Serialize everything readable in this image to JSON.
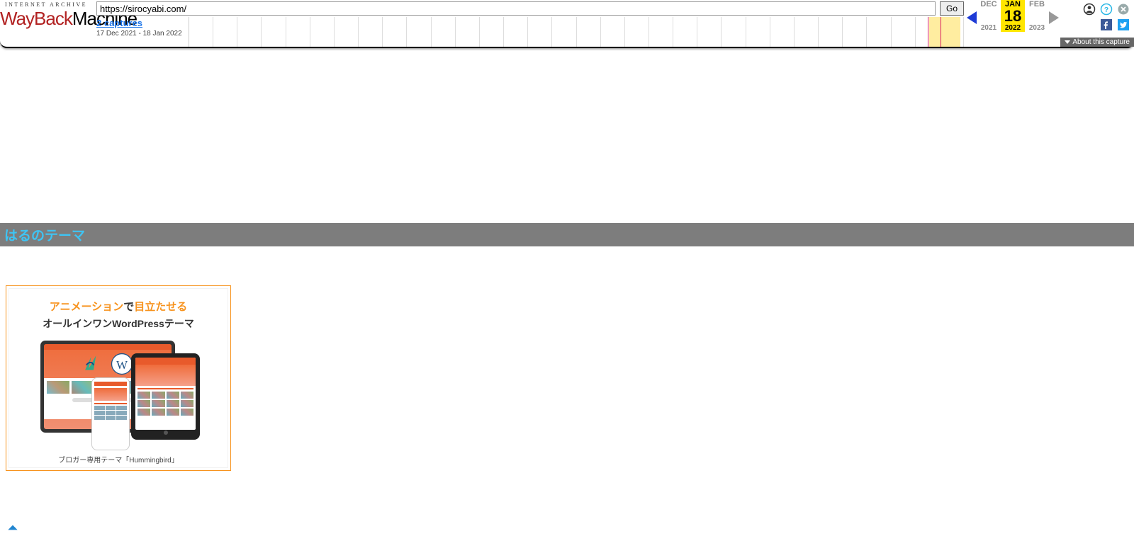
{
  "toolbar": {
    "logo_top": "INTERNET ARCHIVE",
    "logo_wayback": "WayBack",
    "logo_machine": "Machine",
    "url_value": "https://sirocyabi.com/",
    "go_label": "Go",
    "captures_link": "2 captures",
    "date_range": "17 Dec 2021 - 18 Jan 2022",
    "months": {
      "prev": "DEC",
      "current": "JAN",
      "next": "FEB"
    },
    "day": "18",
    "years": {
      "prev": "2021",
      "current": "2022",
      "next": "2023"
    },
    "about_label": "About this capture"
  },
  "content": {
    "band_title": "はるのテーマ"
  },
  "ad": {
    "line1_a": "アニメーション",
    "line1_b": "で",
    "line1_c": "目立たせる",
    "line2": "オールインワンWordPressテーマ",
    "footer": "ブロガー専用テーマ「Hummingbird」"
  }
}
